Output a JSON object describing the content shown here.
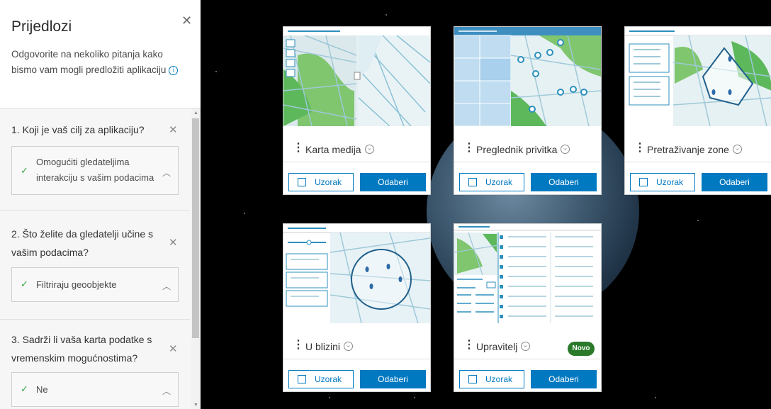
{
  "sidebar": {
    "title": "Prijedlozi",
    "description": "Odgovorite na nekoliko pitanja kako bismo vam mogli predložiti aplikaciju",
    "questions": [
      {
        "text": "1. Koji je vaš cilj za aplikaciju?",
        "answer": "Omogućiti gledateljima interakciju s vašim podacima"
      },
      {
        "text": "2. Što želite da gledatelji učine s vašim podacima?",
        "answer": "Filtriraju geoobjekte"
      },
      {
        "text": "3. Sadrži li vaša karta podatke s vremenskim mogućnostima?",
        "answer": "Ne"
      }
    ]
  },
  "cards": [
    {
      "name": "Karta medija",
      "sample_label": "Uzorak",
      "select_label": "Odaberi"
    },
    {
      "name": "Preglednik privitka",
      "sample_label": "Uzorak",
      "select_label": "Odaberi"
    },
    {
      "name": "Pretraživanje zone",
      "sample_label": "Uzorak",
      "select_label": "Odaberi"
    },
    {
      "name": "U blizini",
      "sample_label": "Uzorak",
      "select_label": "Odaberi"
    },
    {
      "name": "Upravitelj",
      "sample_label": "Uzorak",
      "select_label": "Odaberi",
      "badge": "Novo"
    }
  ],
  "colors": {
    "accent": "#0079c1",
    "check": "#35ac46",
    "badge": "#2a7a2a"
  }
}
